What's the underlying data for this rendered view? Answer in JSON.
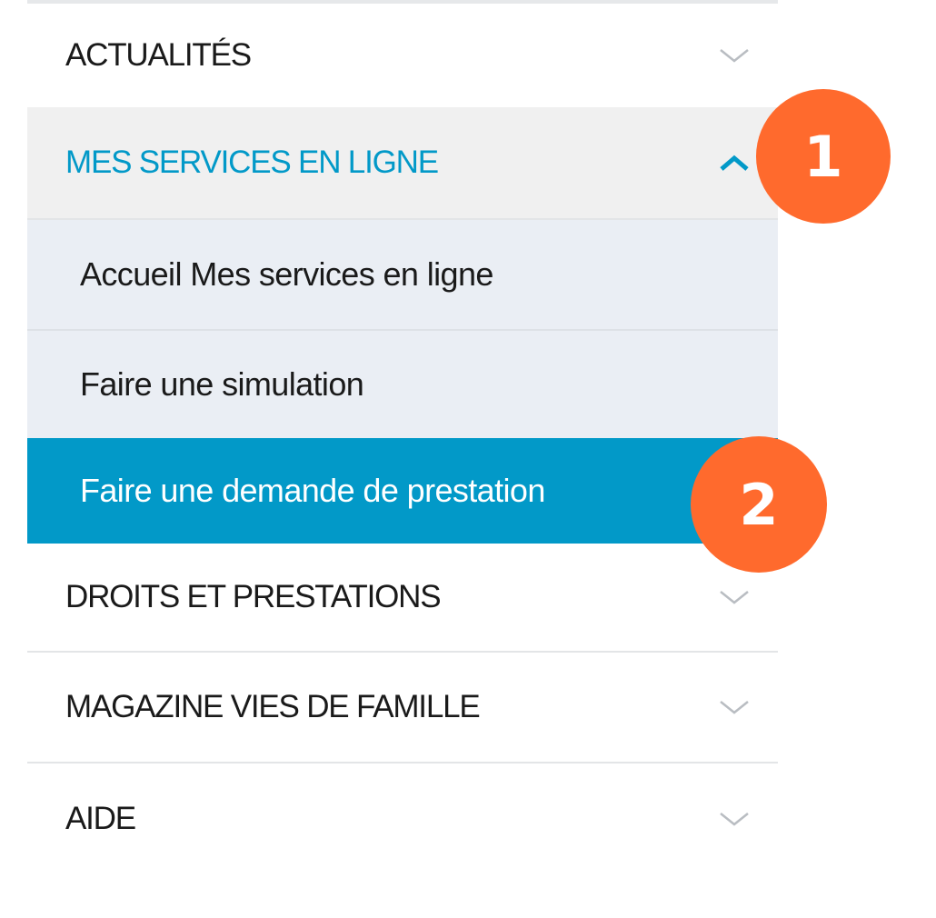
{
  "menu": {
    "items": [
      {
        "label": "ACTUALITÉS",
        "expanded": false
      },
      {
        "label": "MES SERVICES EN LIGNE",
        "expanded": true,
        "subitems": [
          {
            "label": "Accueil Mes services en ligne",
            "active": false
          },
          {
            "label": "Faire une simulation",
            "active": false
          },
          {
            "label": "Faire une demande de prestation",
            "active": true
          }
        ]
      },
      {
        "label": "DROITS ET PRESTATIONS",
        "expanded": false
      },
      {
        "label": "MAGAZINE VIES DE FAMILLE",
        "expanded": false
      },
      {
        "label": "AIDE",
        "expanded": false
      }
    ]
  },
  "icons": {
    "collapsed": "chevron-down-icon",
    "expanded": "chevron-up-icon"
  },
  "annotations": {
    "step1": "1",
    "step2": "2"
  },
  "colors": {
    "accent": "#0299c8",
    "active_bg": "#0299c8",
    "expanded_header_bg": "#f0f0f0",
    "submenu_bg": "#eaeef4",
    "badge": "#ff6a2d"
  }
}
